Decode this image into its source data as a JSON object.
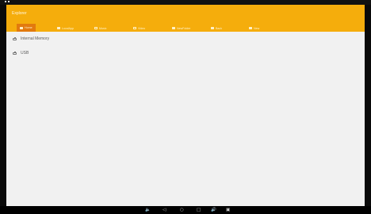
{
  "app": {
    "title": "Explorer"
  },
  "tabs": [
    {
      "label": "Home",
      "icon": "home-icon",
      "active": true
    },
    {
      "label": "LocalApp",
      "icon": "folder-icon",
      "active": false
    },
    {
      "label": "Music",
      "icon": "music-icon",
      "active": false
    },
    {
      "label": "Video",
      "icon": "video-icon",
      "active": false
    },
    {
      "label": "NewFolder",
      "icon": "folder-icon",
      "active": false
    },
    {
      "label": "Back",
      "icon": "back-icon",
      "active": false
    },
    {
      "label": "New",
      "icon": "new-icon",
      "active": false
    }
  ],
  "storage": [
    {
      "label": "Internal Memory",
      "icon": "storage-icon"
    },
    {
      "label": "USB",
      "icon": "usb-icon"
    }
  ],
  "navbar": {
    "volume_down": "🔈",
    "back": "◁",
    "home": "○",
    "recents": "□",
    "volume_up": "🔊",
    "screenshot": "▣"
  },
  "colors": {
    "appbar": "#f5ad0c",
    "active_tab": "#e27a0e",
    "background": "#f1f1f1"
  }
}
